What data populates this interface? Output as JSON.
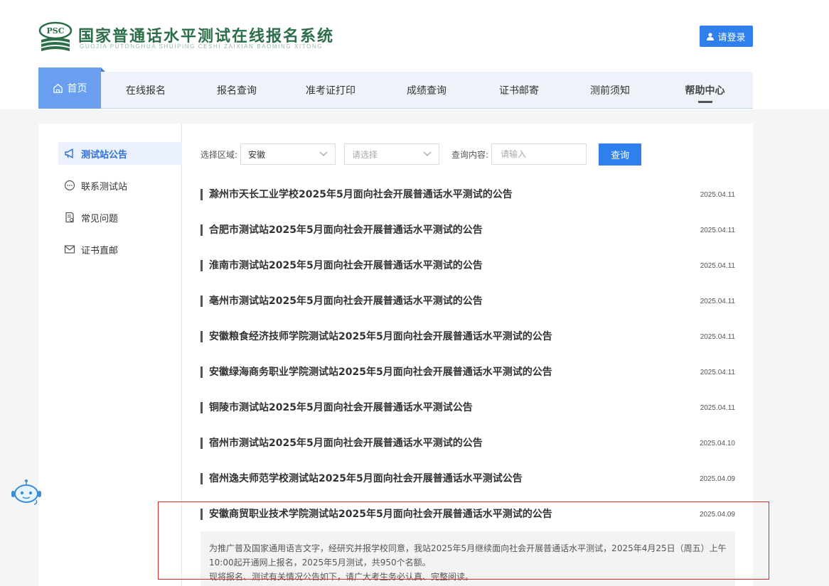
{
  "header": {
    "logo_text": "PSC",
    "title": "国家普通话水平测试在线报名系统",
    "subtitle": "GUOJIA PUTONGHUA SHUIPING CESHI ZAIXIAN BAOMING XITONG",
    "login_label": "请登录",
    "login_icon": "user-icon"
  },
  "nav": {
    "items": [
      {
        "label": "首页",
        "icon": "home-icon"
      },
      {
        "label": "在线报名"
      },
      {
        "label": "报名查询"
      },
      {
        "label": "准考证打印"
      },
      {
        "label": "成绩查询"
      },
      {
        "label": "证书邮寄"
      },
      {
        "label": "测前须知"
      },
      {
        "label": "帮助中心"
      }
    ]
  },
  "sidebar": {
    "items": [
      {
        "label": "测试站公告",
        "icon": "megaphone-icon"
      },
      {
        "label": "联系测试站",
        "icon": "chat-icon"
      },
      {
        "label": "常见问题",
        "icon": "document-icon"
      },
      {
        "label": "证书直邮",
        "icon": "mail-icon"
      }
    ]
  },
  "filter": {
    "region_label": "选择区域:",
    "province_value": "安徽",
    "city_placeholder": "请选择",
    "query_label": "查询内容:",
    "query_placeholder": "请输入",
    "search_button": "查询"
  },
  "announcements": [
    {
      "title": "滁州市天长工业学校2025年5月面向社会开展普通话水平测试的公告",
      "date": "2025.04.11"
    },
    {
      "title": "合肥市测试站2025年5月面向社会开展普通话水平测试的公告",
      "date": "2025.04.11"
    },
    {
      "title": "淮南市测试站2025年5月面向社会开展普通话水平测试的公告",
      "date": "2025.04.11"
    },
    {
      "title": "亳州市测试站2025年5月面向社会开展普通话水平测试的公告",
      "date": "2025.04.11"
    },
    {
      "title": "安徽粮食经济技师学院测试站2025年5月面向社会开展普通话水平测试的公告",
      "date": "2025.04.11"
    },
    {
      "title": "安徽绿海商务职业学院测试站2025年5月面向社会开展普通话水平测试的公告",
      "date": "2025.04.11"
    },
    {
      "title": "铜陵市测试站2025年5月面向社会开展普通话水平测试公告",
      "date": "2025.04.11"
    },
    {
      "title": "宿州市测试站2025年5月面向社会开展普通话水平测试的公告",
      "date": "2025.04.10"
    },
    {
      "title": "宿州逸夫师范学校测试站2025年5月面向社会开展普通话水平测试公告",
      "date": "2025.04.09"
    },
    {
      "title": "安徽商贸职业技术学院测试站2025年5月面向社会开展普通话水平测试的公告",
      "date": "2025.04.09"
    }
  ],
  "expanded_description": {
    "line1": "为推广普及国家通用语言文字，经研究并报学校同意，我站2025年5月继续面向社会开展普通话水平测试，2025年4月25日（周五）上午",
    "line2": "10:00起开通网上报名，2025年5月测试，共950个名额。",
    "line3": "现将报名、测试有关情况公告如下，请广大考生务必认真、完整阅读。"
  },
  "colors": {
    "primary": "#2f80ed",
    "nav_active": "#6a9ff0",
    "logo_green": "#2c6e49",
    "highlight": "#d92b2b"
  },
  "float_icon": "robot-assistant-icon"
}
